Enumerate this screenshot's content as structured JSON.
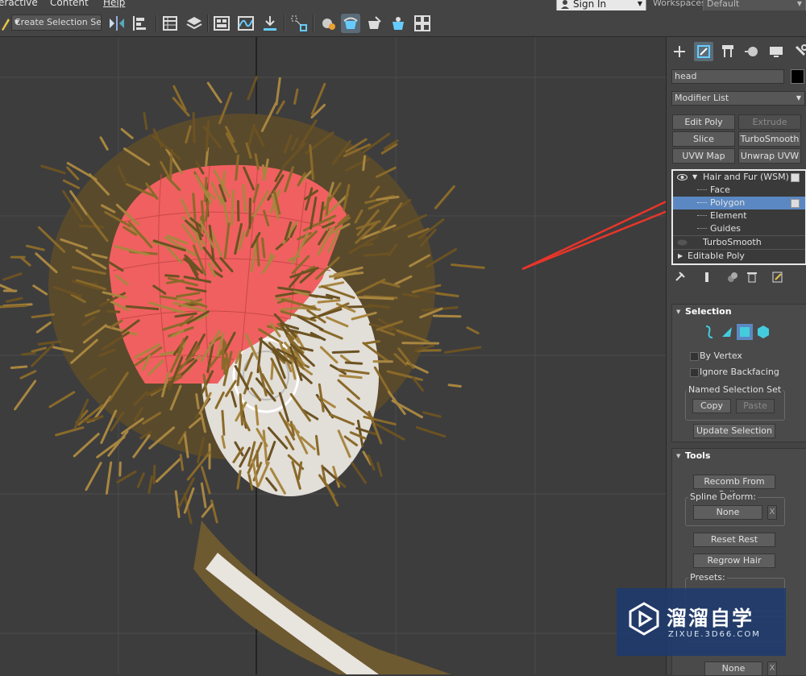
{
  "menu": {
    "items": [
      "eractive",
      "Content",
      "Help"
    ]
  },
  "signin": {
    "label": "Sign In"
  },
  "workspaces": {
    "label": "Workspaces:",
    "value": "Default"
  },
  "toolbar": {
    "selection_set": "Create Selection Set"
  },
  "panel": {
    "object_name": "head",
    "modifier_list": "Modifier List",
    "buttons": [
      "Edit Poly",
      "Extrude",
      "Slice",
      "TurboSmooth",
      "UVW Map",
      "Unwrap UVW"
    ],
    "stack": {
      "items": [
        "Hair and Fur (WSM)",
        "Face",
        "Polygon",
        "Element",
        "Guides",
        "TurboSmooth",
        "Editable Poly"
      ],
      "selected": "Polygon"
    }
  },
  "selection": {
    "title": "Selection",
    "by_vertex": "By Vertex",
    "ignore_backfacing": "Ignore Backfacing",
    "named_set": "Named Selection Set",
    "copy": "Copy",
    "paste": "Paste",
    "update": "Update Selection"
  },
  "tools": {
    "title": "Tools",
    "recomb": "Recomb From Splines",
    "spline_deform": "Spline Deform:",
    "none": "None",
    "x": "X",
    "reset_rest": "Reset Rest",
    "regrow_hair": "Regrow Hair",
    "presets": "Presets:"
  },
  "watermark": {
    "cn": "溜溜自学",
    "en": "ZIXUE.3D66.COM"
  },
  "colors": {
    "selection_face": "#f06060",
    "hair": "#8a6a2a",
    "accent": "#5b88c2",
    "arrow": "#e8352a"
  }
}
